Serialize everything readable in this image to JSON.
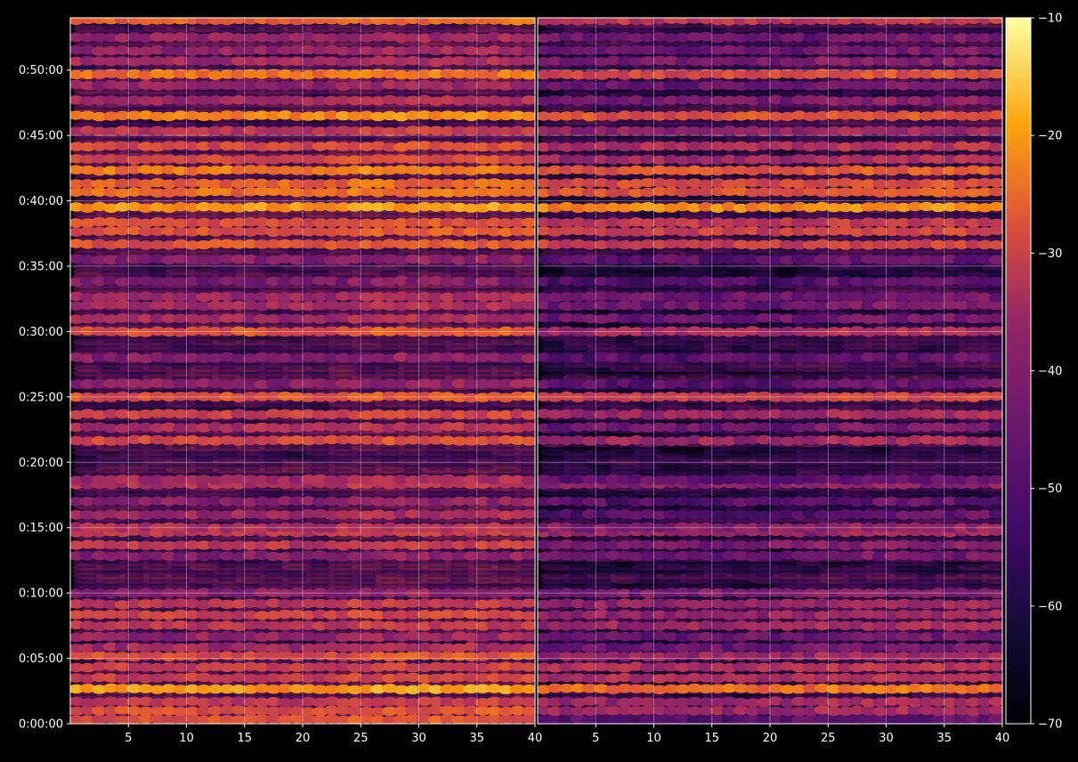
{
  "chart_data": {
    "type": "heatmap",
    "title": "",
    "xlabel": "",
    "ylabel": "",
    "colormap": "inferno",
    "background": "#000000",
    "grid": true,
    "panels": [
      {
        "name": "",
        "x_range": [
          1,
          40
        ],
        "x_ticks": [
          5,
          10,
          15,
          20,
          25,
          30,
          35,
          40
        ]
      },
      {
        "name": "",
        "x_range": [
          1,
          40
        ],
        "x_ticks": [
          5,
          10,
          15,
          20,
          25,
          30,
          35,
          40
        ]
      }
    ],
    "y_axis": {
      "range_seconds": [
        0,
        3240
      ],
      "ticks": [
        {
          "value": 0,
          "label": "0:00:00"
        },
        {
          "value": 300,
          "label": "0:05:00"
        },
        {
          "value": 600,
          "label": "0:10:00"
        },
        {
          "value": 900,
          "label": "0:15:00"
        },
        {
          "value": 1200,
          "label": "0:20:00"
        },
        {
          "value": 1500,
          "label": "0:25:00"
        },
        {
          "value": 1800,
          "label": "0:30:00"
        },
        {
          "value": 2100,
          "label": "0:35:00"
        },
        {
          "value": 2400,
          "label": "0:40:00"
        },
        {
          "value": 2700,
          "label": "0:45:00"
        },
        {
          "value": 3000,
          "label": "0:50:00"
        }
      ]
    },
    "colorbar": {
      "range": [
        -70,
        -10
      ],
      "ticks": [
        -70,
        -60,
        -50,
        -40,
        -30,
        -20,
        -10
      ],
      "tick_labels": [
        "−70",
        "−60",
        "−50",
        "−40",
        "−30",
        "−20",
        "−10"
      ]
    },
    "bands": [
      {
        "t": 20,
        "level": -35,
        "level_b": -55
      },
      {
        "t": 60,
        "level": -35,
        "level_b": -45
      },
      {
        "t": 100,
        "level": -40,
        "level_b": -45
      },
      {
        "t": 160,
        "level": -24,
        "level_b": -30
      },
      {
        "t": 210,
        "level": -38,
        "level_b": -42
      },
      {
        "t": 260,
        "level": -38,
        "level_b": -42
      },
      {
        "t": 310,
        "level": -35,
        "level_b": -45
      },
      {
        "t": 350,
        "level": -44,
        "level_b": -52
      },
      {
        "t": 400,
        "level": -46,
        "level_b": -52
      },
      {
        "t": 450,
        "level": -40,
        "level_b": -45
      },
      {
        "t": 500,
        "level": -38,
        "level_b": -46
      },
      {
        "t": 550,
        "level": -40,
        "level_b": -46
      },
      {
        "t": 600,
        "level": -48,
        "level_b": -50
      },
      {
        "t": 770,
        "level": -48,
        "level_b": -52
      },
      {
        "t": 820,
        "level": -40,
        "level_b": -50
      },
      {
        "t": 880,
        "level": -40,
        "level_b": -46
      },
      {
        "t": 900,
        "level": -42,
        "level_b": -48
      },
      {
        "t": 960,
        "level": -44,
        "level_b": -55
      },
      {
        "t": 1020,
        "level": -48,
        "level_b": -55
      },
      {
        "t": 1100,
        "level": -42,
        "level_b": -48
      },
      {
        "t": 1120,
        "level": -44,
        "level_b": -54
      },
      {
        "t": 1300,
        "level": -36,
        "level_b": -45
      },
      {
        "t": 1360,
        "level": -42,
        "level_b": -52
      },
      {
        "t": 1420,
        "level": -38,
        "level_b": -45
      },
      {
        "t": 1500,
        "level": -34,
        "level_b": -38
      },
      {
        "t": 1560,
        "level": -48,
        "level_b": -54
      },
      {
        "t": 1680,
        "level": -48,
        "level_b": -55
      },
      {
        "t": 1800,
        "level": -34,
        "level_b": -44
      },
      {
        "t": 1860,
        "level": -44,
        "level_b": -52
      },
      {
        "t": 1920,
        "level": -44,
        "level_b": -52
      },
      {
        "t": 1960,
        "level": -45,
        "level_b": -52
      },
      {
        "t": 2030,
        "level": -50,
        "level_b": -56
      },
      {
        "t": 2130,
        "level": -48,
        "level_b": -54
      },
      {
        "t": 2200,
        "level": -34,
        "level_b": -38
      },
      {
        "t": 2260,
        "level": -34,
        "level_b": -38
      },
      {
        "t": 2300,
        "level": -35,
        "level_b": -40
      },
      {
        "t": 2370,
        "level": -24,
        "level_b": -26
      },
      {
        "t": 2440,
        "level": -30,
        "level_b": -34
      },
      {
        "t": 2480,
        "level": -32,
        "level_b": -36
      },
      {
        "t": 2540,
        "level": -28,
        "level_b": -34
      },
      {
        "t": 2590,
        "level": -36,
        "level_b": -44
      },
      {
        "t": 2650,
        "level": -36,
        "level_b": -42
      },
      {
        "t": 2720,
        "level": -40,
        "level_b": -46
      },
      {
        "t": 2790,
        "level": -26,
        "level_b": -34
      },
      {
        "t": 2860,
        "level": -44,
        "level_b": -50
      },
      {
        "t": 2930,
        "level": -46,
        "level_b": -52
      },
      {
        "t": 2980,
        "level": -30,
        "level_b": -36
      },
      {
        "t": 3040,
        "level": -44,
        "level_b": -50
      },
      {
        "t": 3090,
        "level": -46,
        "level_b": -52
      },
      {
        "t": 3150,
        "level": -46,
        "level_b": -52
      },
      {
        "t": 3230,
        "level": -32,
        "level_b": -40
      }
    ]
  }
}
